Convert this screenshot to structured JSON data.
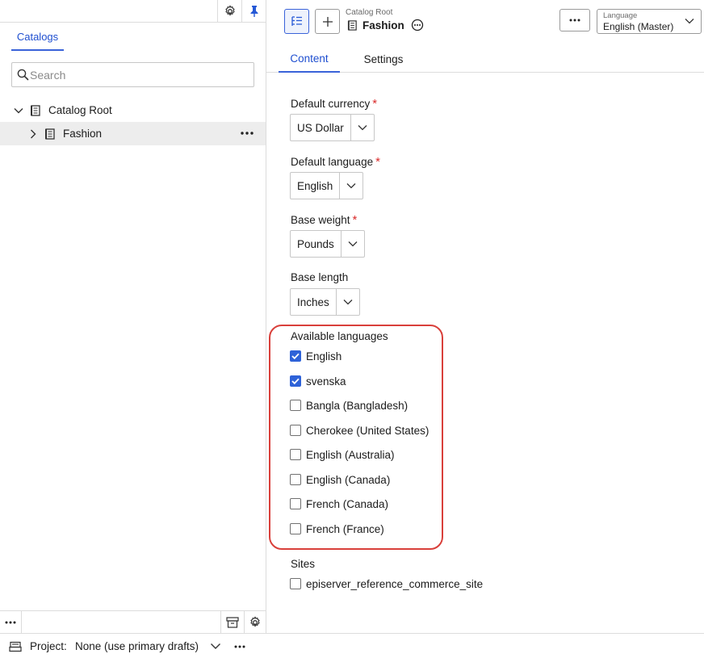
{
  "navigation": {
    "tabs": [
      {
        "label": "Catalogs",
        "active": true
      }
    ],
    "search": {
      "placeholder": "Search",
      "value": ""
    },
    "tree": [
      {
        "label": "Catalog Root",
        "expanded": true,
        "icon": "catalog-icon"
      },
      {
        "label": "Fashion",
        "expanded": false,
        "selected": true,
        "icon": "catalog-icon"
      }
    ]
  },
  "header": {
    "breadcrumb": "Catalog Root",
    "title": "Fashion",
    "language_caption": "Language",
    "language_value": "English (Master)"
  },
  "content_tabs": [
    {
      "label": "Content",
      "active": true
    },
    {
      "label": "Settings",
      "active": false
    }
  ],
  "form": {
    "default_currency": {
      "label": "Default currency",
      "value": "US Dollar",
      "required": "*"
    },
    "default_language": {
      "label": "Default language",
      "value": "English",
      "required": "*"
    },
    "base_weight": {
      "label": "Base weight",
      "value": "Pounds",
      "required": "*"
    },
    "base_length": {
      "label": "Base length",
      "value": "Inches"
    },
    "available_languages": {
      "label": "Available languages",
      "options": [
        {
          "label": "English",
          "checked": true
        },
        {
          "label": "svenska",
          "checked": true
        },
        {
          "label": "Bangla (Bangladesh)",
          "checked": false
        },
        {
          "label": "Cherokee (United States)",
          "checked": false
        },
        {
          "label": "English (Australia)",
          "checked": false
        },
        {
          "label": "English (Canada)",
          "checked": false
        },
        {
          "label": "French (Canada)",
          "checked": false
        },
        {
          "label": "French (France)",
          "checked": false
        }
      ]
    },
    "sites": {
      "label": "Sites",
      "options": [
        {
          "label": "episerver_reference_commerce_site",
          "checked": false
        }
      ]
    }
  },
  "footer": {
    "project_label": "Project:",
    "project_value": "None (use primary drafts)"
  },
  "colors": {
    "accent": "#3a63d9",
    "required": "#d92b2b",
    "highlight": "#d9403b",
    "checkbox_checked": "#2e62d8"
  }
}
